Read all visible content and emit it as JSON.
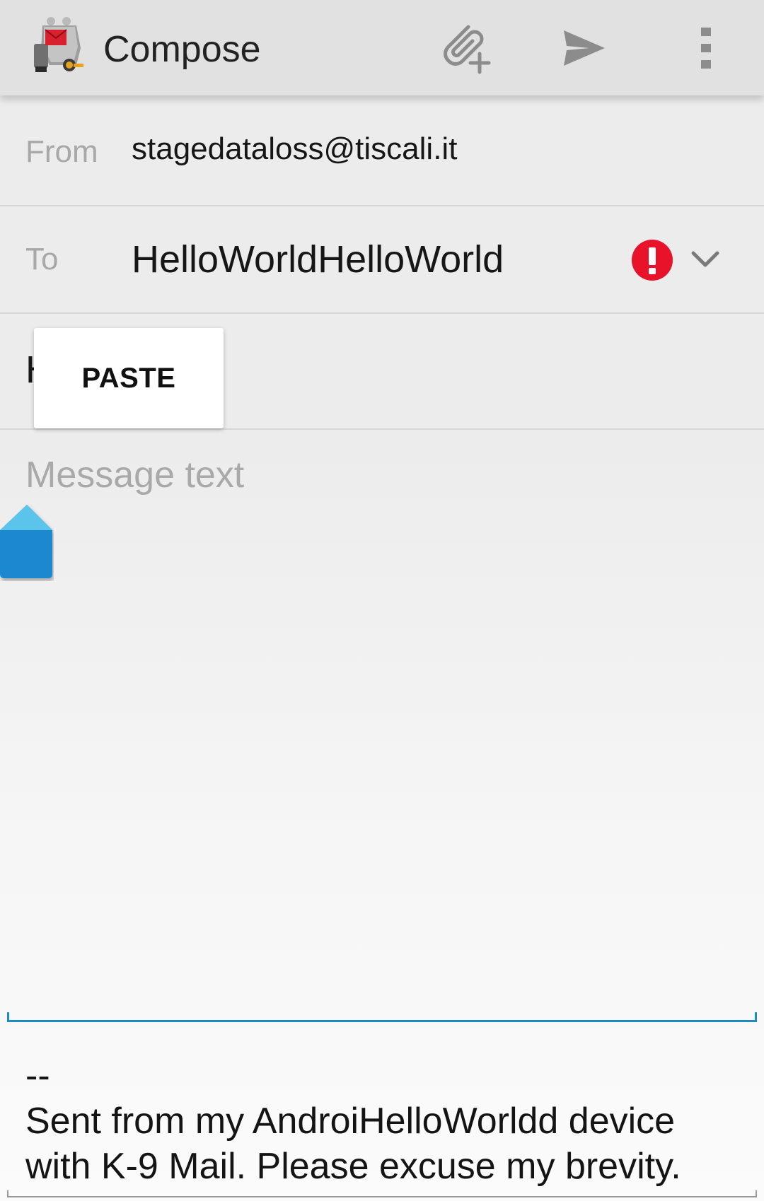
{
  "app_bar": {
    "title": "Compose",
    "icons": {
      "app": "k9-mail-dog-icon",
      "attach": "attach-file-plus-icon",
      "send": "send-icon",
      "overflow": "more-vert-icon"
    }
  },
  "from": {
    "label": "From",
    "value": "stagedataloss@tiscali.it"
  },
  "to": {
    "label": "To",
    "value": "HelloWorldHelloWorld",
    "status_icon": "error-icon",
    "status_color": "#e8122b",
    "expand_icon": "chevron-down-icon"
  },
  "subject": {
    "value": "H"
  },
  "context_menu": {
    "paste_label": "PASTE"
  },
  "message": {
    "placeholder": "Message text",
    "accent_color": "#1f8ac6"
  },
  "signature": {
    "separator": "--",
    "line1": "Sent from my AndroiHelloWorldd device",
    "line2": "with K-9 Mail. Please excuse my brevity."
  }
}
